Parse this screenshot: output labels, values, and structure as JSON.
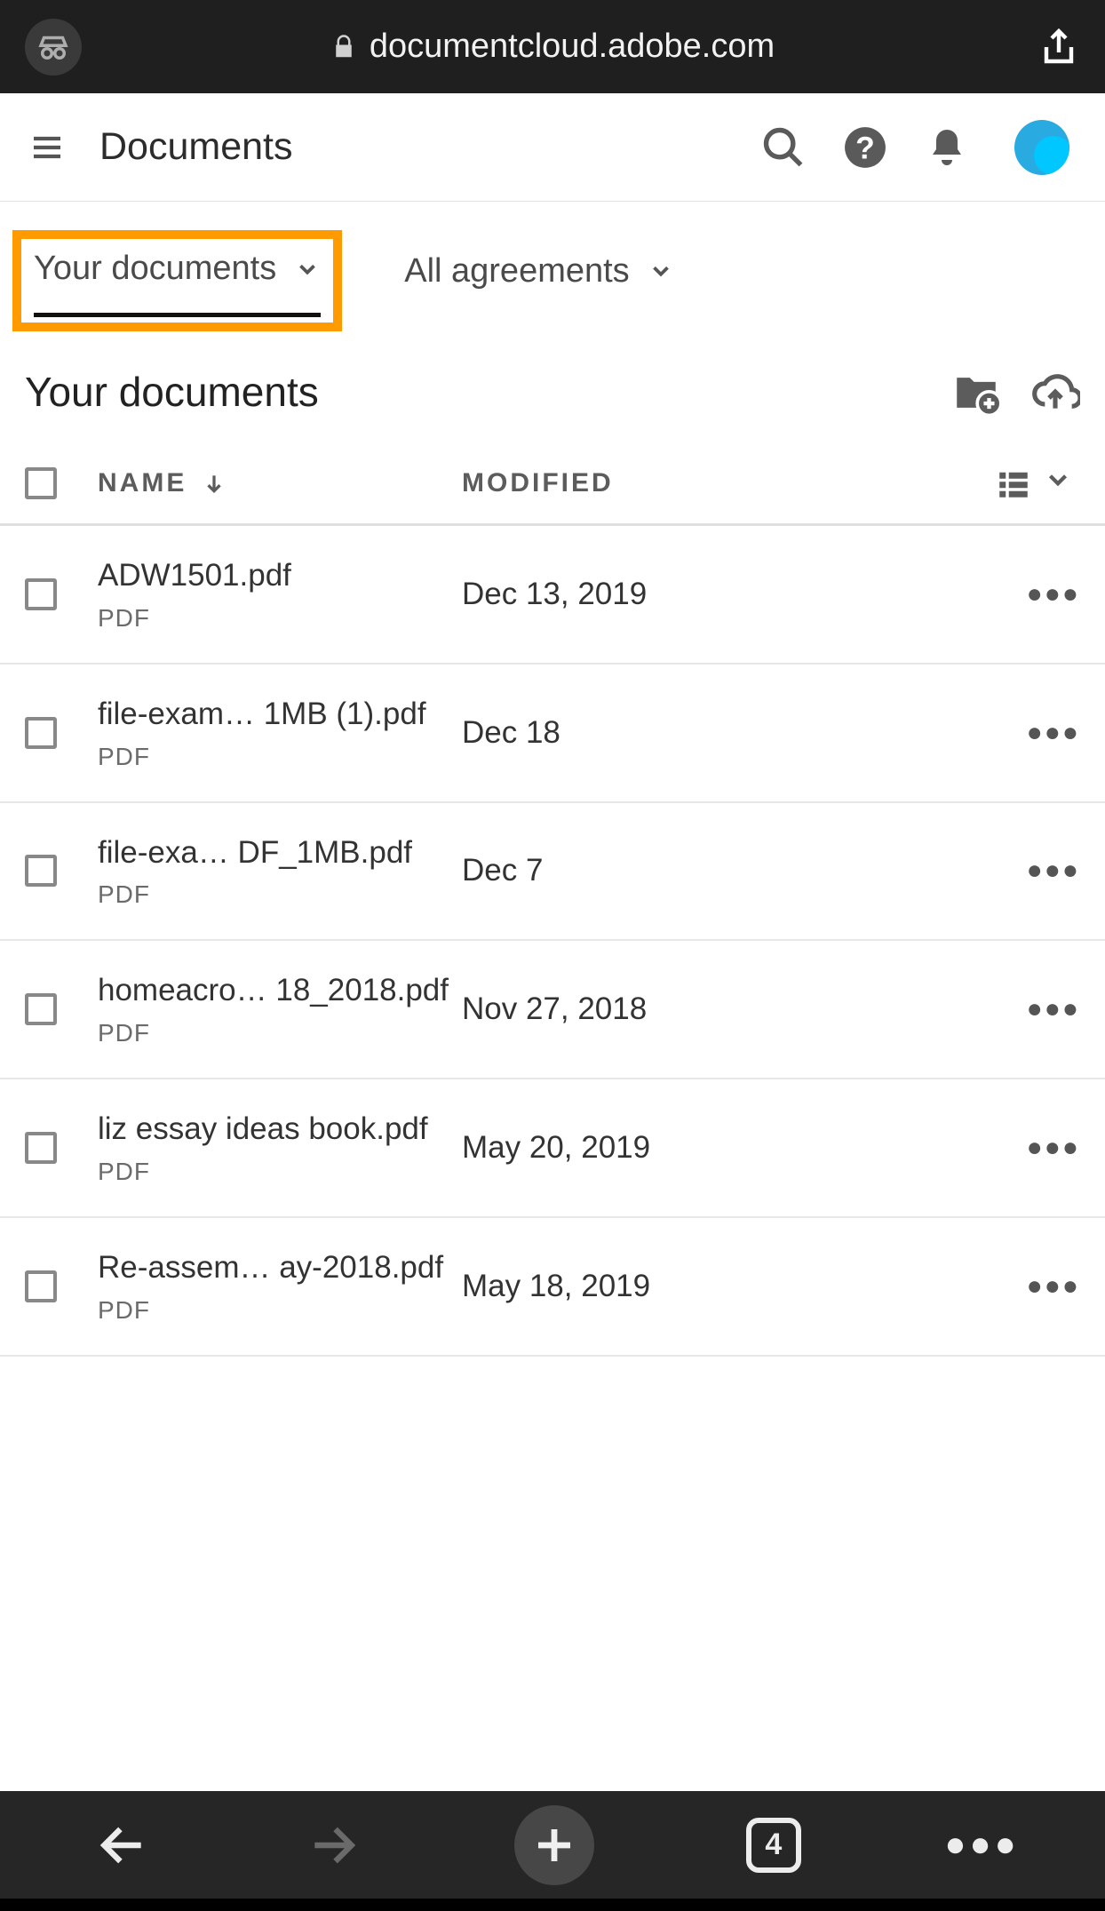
{
  "browser": {
    "url": "documentcloud.adobe.com",
    "tab_count": "4"
  },
  "header": {
    "title": "Documents"
  },
  "tabs": {
    "your_documents": "Your documents",
    "all_agreements": "All agreements"
  },
  "section": {
    "title": "Your documents"
  },
  "columns": {
    "name": "NAME",
    "modified": "MODIFIED"
  },
  "files": [
    {
      "name": "ADW1501.pdf",
      "type": "PDF",
      "modified": "Dec 13, 2019"
    },
    {
      "name": "file-exam… 1MB (1).pdf",
      "type": "PDF",
      "modified": "Dec 18"
    },
    {
      "name": "file-exa…  DF_1MB.pdf",
      "type": "PDF",
      "modified": "Dec 7"
    },
    {
      "name": "homeacro… 18_2018.pdf",
      "type": "PDF",
      "modified": "Nov 27, 2018"
    },
    {
      "name": "liz essay ideas book.pdf",
      "type": "PDF",
      "modified": "May 20, 2019"
    },
    {
      "name": "Re-assem… ay-2018.pdf",
      "type": "PDF",
      "modified": "May 18, 2019"
    }
  ]
}
